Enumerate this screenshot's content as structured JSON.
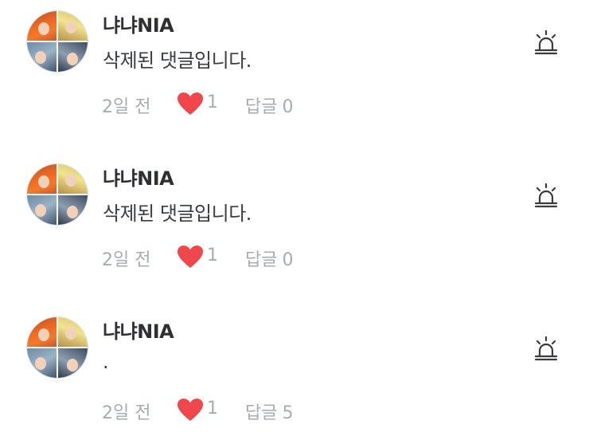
{
  "colors": {
    "heart": "#f0474c",
    "meta_text": "#a7abb2",
    "username_text": "#2f3033",
    "body_text": "#3c3d40",
    "icon_stroke": "#3a3b3e"
  },
  "icons": {
    "report": "siren-icon",
    "like": "heart-icon"
  },
  "comments": [
    {
      "username": "냐냐NIA",
      "text": "삭제된 댓글입니다.",
      "time": "2일 전",
      "likes": "1",
      "reply_label": "답글",
      "reply_count": "0"
    },
    {
      "username": "냐냐NIA",
      "text": "삭제된 댓글입니다.",
      "time": "2일 전",
      "likes": "1",
      "reply_label": "답글",
      "reply_count": "0"
    },
    {
      "username": "냐냐NIA",
      "text": ".",
      "time": "2일 전",
      "likes": "1",
      "reply_label": "답글",
      "reply_count": "5"
    }
  ]
}
